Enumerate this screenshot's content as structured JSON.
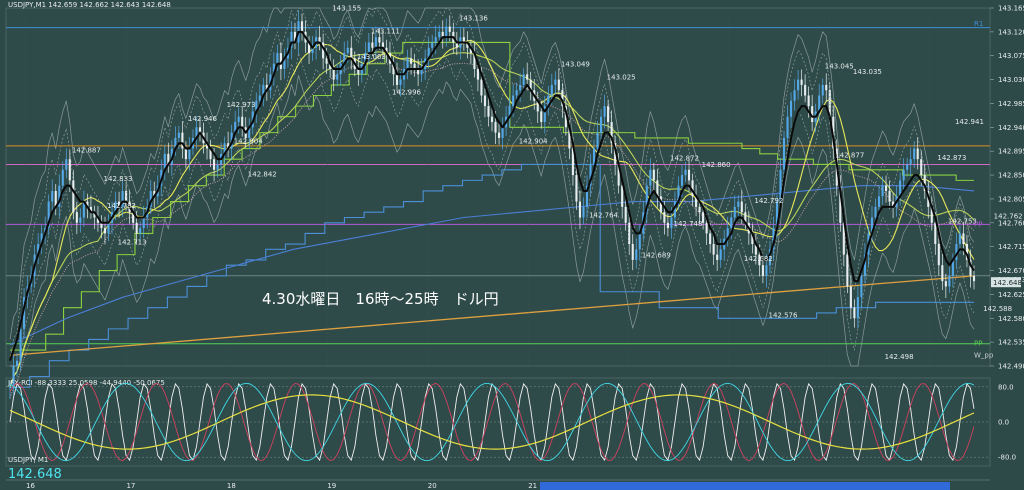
{
  "chart_data": [
    {
      "type": "line",
      "header": "USDJPY,M1  142.659 142.662 142.643 142.648",
      "annotation": "4.30水曜日　16時～25時　ドル円",
      "symbol": "USDJPY, M1",
      "last_price": "142.648",
      "ylim": [
        142.49,
        143.165
      ],
      "y_ticks": [
        "143.165",
        "143.120",
        "143.075",
        "143.030",
        "142.985",
        "142.940",
        "142.895",
        "142.850",
        "142.805",
        "142.760",
        "142.715",
        "142.670",
        "142.625",
        "142.580",
        "142.535",
        "142.490"
      ],
      "x_ticks": [
        "16",
        "17",
        "18",
        "19",
        "20",
        "21",
        "22",
        "23",
        "0",
        "1"
      ],
      "price_labels": [
        {
          "t": 21,
          "v": 142.887
        },
        {
          "t": 30,
          "v": 142.833
        },
        {
          "t": 31,
          "v": 142.782
        },
        {
          "t": 34,
          "v": 142.713
        },
        {
          "t": 54,
          "v": 142.946
        },
        {
          "t": 71,
          "v": 142.842
        },
        {
          "t": 67,
          "v": 142.904
        },
        {
          "t": 65,
          "v": 142.973
        },
        {
          "t": 95,
          "v": 143.155
        },
        {
          "t": 106,
          "v": 143.111
        },
        {
          "t": 102,
          "v": 143.063
        },
        {
          "t": 112,
          "v": 142.996
        },
        {
          "t": 131,
          "v": 143.136
        },
        {
          "t": 148,
          "v": 142.904
        },
        {
          "t": 160,
          "v": 143.049
        },
        {
          "t": 173,
          "v": 143.025
        },
        {
          "t": 168,
          "v": 142.764
        },
        {
          "t": 183,
          "v": 142.689
        },
        {
          "t": 192,
          "v": 142.748
        },
        {
          "t": 191,
          "v": 142.872
        },
        {
          "t": 200,
          "v": 142.86
        },
        {
          "t": 212,
          "v": 142.682
        },
        {
          "t": 215,
          "v": 142.792
        },
        {
          "t": 219,
          "v": 142.576
        },
        {
          "t": 235,
          "v": 143.045
        },
        {
          "t": 243,
          "v": 143.035
        },
        {
          "t": 238,
          "v": 142.877
        },
        {
          "t": 252,
          "v": 142.498
        },
        {
          "t": 272,
          "v": 142.941
        },
        {
          "t": 267,
          "v": 142.873
        },
        {
          "t": 270,
          "v": 142.753
        },
        {
          "t": 283,
          "v": 142.762
        },
        {
          "t": 280,
          "v": 142.588
        },
        {
          "t": 284,
          "v": 142.643
        }
      ],
      "close": [
        142.45,
        142.49,
        142.5,
        142.56,
        142.62,
        142.64,
        142.66,
        142.7,
        142.72,
        142.74,
        142.75,
        142.8,
        142.82,
        142.79,
        142.83,
        142.86,
        142.88,
        142.84,
        142.78,
        142.76,
        142.77,
        142.8,
        142.79,
        142.78,
        142.77,
        142.76,
        142.75,
        142.74,
        142.76,
        142.78,
        142.8,
        142.79,
        142.82,
        142.8,
        142.78,
        142.76,
        142.74,
        142.75,
        142.77,
        142.79,
        142.82,
        142.81,
        142.83,
        142.86,
        142.89,
        142.87,
        142.9,
        142.92,
        142.93,
        142.9,
        142.88,
        142.9,
        142.92,
        142.94,
        142.93,
        142.91,
        142.9,
        142.88,
        142.86,
        142.87,
        142.89,
        142.91,
        142.9,
        142.93,
        142.95,
        142.96,
        142.94,
        142.92,
        142.94,
        142.97,
        142.99,
        143.0,
        143.02,
        143.01,
        143.04,
        143.06,
        143.08,
        143.05,
        143.07,
        143.09,
        143.12,
        143.1,
        143.14,
        143.12,
        143.1,
        143.08,
        143.09,
        143.11,
        143.1,
        143.07,
        143.06,
        143.05,
        143.03,
        143.04,
        143.06,
        143.08,
        143.09,
        143.07,
        143.05,
        143.04,
        143.06,
        143.08,
        143.1,
        143.09,
        143.11,
        143.1,
        143.09,
        143.08,
        143.06,
        143.04,
        143.02,
        143.03,
        143.05,
        143.07,
        143.06,
        143.05,
        143.04,
        143.05,
        143.07,
        143.09,
        143.1,
        143.11,
        143.12,
        143.11,
        143.13,
        143.12,
        143.1,
        143.09,
        143.11,
        143.1,
        143.09,
        143.08,
        143.05,
        143.03,
        143.0,
        142.98,
        142.96,
        142.95,
        142.93,
        142.92,
        142.94,
        142.96,
        142.98,
        143.0,
        143.01,
        143.02,
        143.04,
        143.03,
        143.01,
        142.99,
        142.97,
        142.95,
        142.98,
        143.0,
        143.02,
        143.03,
        143.01,
        142.98,
        142.94,
        142.9,
        142.85,
        142.8,
        142.77,
        142.79,
        142.83,
        142.87,
        142.9,
        142.93,
        142.96,
        142.98,
        142.95,
        142.91,
        142.87,
        142.83,
        142.79,
        142.76,
        142.72,
        142.69,
        142.71,
        142.74,
        142.78,
        142.83,
        142.86,
        142.84,
        142.81,
        142.78,
        142.76,
        142.75,
        142.77,
        142.8,
        142.83,
        142.85,
        142.86,
        142.84,
        142.81,
        142.79,
        142.78,
        142.76,
        142.74,
        142.72,
        142.7,
        142.69,
        142.71,
        142.73,
        142.75,
        142.77,
        142.79,
        142.8,
        142.78,
        142.76,
        142.74,
        142.72,
        142.7,
        142.68,
        142.66,
        142.68,
        142.71,
        142.75,
        142.8,
        142.86,
        142.92,
        142.96,
        142.99,
        143.01,
        143.03,
        143.02,
        143.0,
        142.98,
        142.95,
        142.97,
        143.0,
        143.02,
        143.01,
        142.96,
        142.9,
        142.83,
        142.76,
        142.7,
        142.64,
        142.6,
        142.58,
        142.62,
        142.66,
        142.7,
        142.74,
        142.77,
        142.79,
        142.81,
        142.83,
        142.82,
        142.8,
        142.79,
        142.81,
        142.84,
        142.86,
        142.87,
        142.88,
        142.9,
        142.88,
        142.85,
        142.82,
        142.79,
        142.76,
        142.72,
        142.68,
        142.65,
        142.64,
        142.66,
        142.69,
        142.72,
        142.74,
        142.72,
        142.69,
        142.66,
        142.65
      ],
      "overlays": {
        "ma_fast": [
          142.5,
          142.52,
          142.54,
          142.57,
          142.6,
          142.63,
          142.65,
          142.68,
          142.7,
          142.72,
          142.74,
          142.76,
          142.78,
          142.79,
          142.8,
          142.82,
          142.83,
          142.83,
          142.82,
          142.81,
          142.8,
          142.8,
          142.79,
          142.78,
          142.78,
          142.77,
          142.76,
          142.76,
          142.76,
          142.77,
          142.78,
          142.79,
          142.8,
          142.8,
          142.79,
          142.78,
          142.77,
          142.77,
          142.77,
          142.78,
          142.8,
          142.81,
          142.82,
          142.84,
          142.86,
          142.87,
          142.88,
          142.9,
          142.91,
          142.91,
          142.9,
          142.9,
          142.91,
          142.92,
          142.93,
          142.92,
          142.91,
          142.9,
          142.89,
          142.88,
          142.88,
          142.89,
          142.9,
          142.91,
          142.93,
          142.94,
          142.94,
          142.93,
          142.94,
          142.95,
          142.97,
          142.98,
          143.0,
          143.01,
          143.02,
          143.04,
          143.06,
          143.06,
          143.07,
          143.08,
          143.1,
          143.1,
          143.12,
          143.12,
          143.11,
          143.1,
          143.09,
          143.1,
          143.1,
          143.09,
          143.08,
          143.06,
          143.05,
          143.05,
          143.05,
          143.06,
          143.07,
          143.07,
          143.06,
          143.05,
          143.05,
          143.06,
          143.08,
          143.08,
          143.09,
          143.09,
          143.09,
          143.08,
          143.07,
          143.06,
          143.04,
          143.04,
          143.04,
          143.05,
          143.05,
          143.05,
          143.05,
          143.05,
          143.06,
          143.07,
          143.08,
          143.09,
          143.1,
          143.11,
          143.11,
          143.11,
          143.11,
          143.1,
          143.1,
          143.1,
          143.1,
          143.09,
          143.08,
          143.06,
          143.04,
          143.02,
          143.0,
          142.98,
          142.96,
          142.95,
          142.94,
          142.95,
          142.96,
          142.97,
          142.99,
          143.0,
          143.01,
          143.02,
          143.01,
          143.0,
          142.99,
          142.98,
          142.97,
          142.98,
          142.99,
          143.0,
          143.0,
          142.99,
          142.97,
          142.94,
          142.91,
          142.87,
          142.84,
          142.82,
          142.82,
          142.84,
          142.86,
          142.89,
          142.91,
          142.93,
          142.93,
          142.92,
          142.9,
          142.87,
          142.84,
          142.81,
          142.78,
          142.75,
          142.74,
          142.74,
          142.76,
          142.79,
          142.81,
          142.82,
          142.81,
          142.8,
          142.79,
          142.78,
          142.78,
          142.79,
          142.8,
          142.82,
          142.83,
          142.83,
          142.82,
          142.81,
          142.8,
          142.79,
          142.77,
          142.75,
          142.74,
          142.72,
          142.72,
          142.72,
          142.73,
          142.74,
          142.76,
          142.77,
          142.77,
          142.76,
          142.75,
          142.74,
          142.72,
          142.71,
          142.69,
          142.69,
          142.7,
          142.72,
          142.75,
          142.79,
          142.84,
          142.88,
          142.92,
          142.95,
          142.97,
          142.98,
          142.98,
          142.97,
          142.96,
          142.96,
          142.97,
          142.98,
          142.98,
          142.96,
          142.92,
          142.87,
          142.82,
          142.77,
          142.72,
          142.68,
          142.65,
          142.65,
          142.67,
          142.69,
          142.72,
          142.74,
          142.76,
          142.78,
          142.79,
          142.79,
          142.79,
          142.79,
          142.8,
          142.81,
          142.82,
          142.83,
          142.84,
          142.85,
          142.85,
          142.84,
          142.83,
          142.81,
          142.79,
          142.77,
          142.74,
          142.71,
          142.69,
          142.68,
          142.69,
          142.7,
          142.71,
          142.71,
          142.7,
          142.68,
          142.67
        ],
        "step_high": [
          142.52,
          142.52,
          142.55,
          142.6,
          142.63,
          142.67,
          142.7,
          142.74,
          142.77,
          142.8,
          142.83,
          142.85,
          142.88,
          142.9,
          142.93,
          142.96,
          142.98,
          143.0,
          143.02,
          143.04,
          143.06,
          143.08,
          143.1,
          143.1,
          143.1,
          143.1,
          143.1,
          143.1,
          142.94,
          142.94,
          142.94,
          142.93,
          142.93,
          142.93,
          142.93,
          142.92,
          142.92,
          142.92,
          142.91,
          142.91,
          142.91,
          142.9,
          142.89,
          142.88,
          142.88,
          142.87,
          142.87,
          142.86,
          142.86,
          142.86,
          142.85,
          142.85,
          142.85,
          142.84,
          142.84
        ],
        "step_low": [
          142.45,
          142.47,
          142.5,
          142.52,
          142.54,
          142.56,
          142.58,
          142.6,
          142.62,
          142.64,
          142.66,
          142.68,
          142.69,
          142.71,
          142.72,
          142.74,
          142.76,
          142.77,
          142.78,
          142.79,
          142.8,
          142.82,
          142.83,
          142.84,
          142.85,
          142.86,
          142.87,
          142.87,
          142.87,
          142.87,
          142.63,
          142.63,
          142.63,
          142.6,
          142.6,
          142.6,
          142.58,
          142.58,
          142.58,
          142.58,
          142.58,
          142.59,
          142.6,
          142.6,
          142.61,
          142.61,
          142.61,
          142.61,
          142.61,
          142.61
        ],
        "ma_long": [
          142.53,
          142.58,
          142.62,
          142.65,
          142.68,
          142.71,
          142.73,
          142.75,
          142.77,
          142.78,
          142.79,
          142.8,
          142.8,
          142.81,
          142.82,
          142.83,
          142.83,
          142.82
        ]
      },
      "levels": [
        {
          "name": "R",
          "value": 143.128,
          "color": "#3f8fd8"
        },
        {
          "name": "orange",
          "value": 142.905,
          "color": "#d9912a"
        },
        {
          "name": "magenta",
          "value": 142.87,
          "color": "#d06ac0"
        },
        {
          "name": "PP",
          "value": 142.757,
          "color": "#b35ad8"
        },
        {
          "name": "close",
          "value": 142.66,
          "color": "#8fa5a5"
        },
        {
          "name": "PP2",
          "value": 142.532,
          "color": "#55d055"
        }
      ],
      "right_tags": [
        "R1",
        "PP",
        "PP",
        "W_pp"
      ],
      "colors": {
        "candle_up": "#55a8e8",
        "candle_dn": "#e8eef0",
        "ma_fast": "#0a0a0a",
        "ma_mid": "#e8e85a",
        "ma_mid2": "#b8d058",
        "ma_env": "#c0a0a0",
        "ma_long": "#e0a040",
        "step": "#8ad040",
        "step_low": "#4a8fd8",
        "bb": "#8a9a9a",
        "trend": "#4a7fd8"
      }
    },
    {
      "type": "line",
      "header": "JFX-RCI -88.3333 25.0598 -44.9440 -50.0675",
      "ylim": [
        -100,
        100
      ],
      "y_ticks": [
        "80.0",
        "0.0",
        "-80.0"
      ],
      "series_colors": [
        "#f0f0f0",
        "#d04060",
        "#40d8e8",
        "#e8e040"
      ],
      "series_periods": [
        5,
        11,
        19,
        58
      ]
    }
  ]
}
